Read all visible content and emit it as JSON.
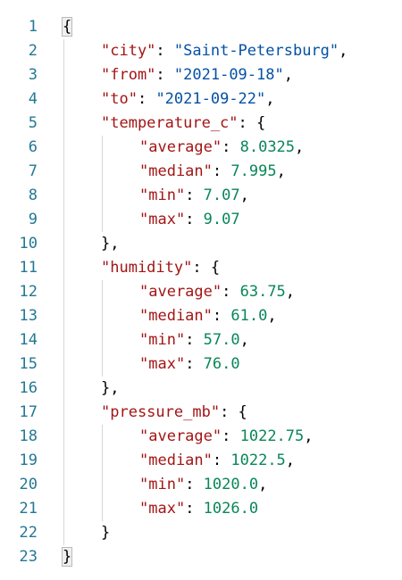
{
  "editor": {
    "colors": {
      "key": "#a31515",
      "string": "#0451a5",
      "number": "#098658",
      "line_number": "#237893"
    },
    "lines": [
      {
        "n": "1",
        "indent": 0,
        "tokens": [
          {
            "t": "{",
            "c": "pun",
            "hl": true
          }
        ]
      },
      {
        "n": "2",
        "indent": 1,
        "tokens": [
          {
            "t": "\"city\"",
            "c": "key"
          },
          {
            "t": ": ",
            "c": "pun"
          },
          {
            "t": "\"Saint-Petersburg\"",
            "c": "str"
          },
          {
            "t": ",",
            "c": "pun"
          }
        ]
      },
      {
        "n": "3",
        "indent": 1,
        "tokens": [
          {
            "t": "\"from\"",
            "c": "key"
          },
          {
            "t": ": ",
            "c": "pun"
          },
          {
            "t": "\"2021-09-18\"",
            "c": "str"
          },
          {
            "t": ",",
            "c": "pun"
          }
        ]
      },
      {
        "n": "4",
        "indent": 1,
        "tokens": [
          {
            "t": "\"to\"",
            "c": "key"
          },
          {
            "t": ": ",
            "c": "pun"
          },
          {
            "t": "\"2021-09-22\"",
            "c": "str"
          },
          {
            "t": ",",
            "c": "pun"
          }
        ]
      },
      {
        "n": "5",
        "indent": 1,
        "tokens": [
          {
            "t": "\"temperature_c\"",
            "c": "key"
          },
          {
            "t": ": {",
            "c": "pun"
          }
        ]
      },
      {
        "n": "6",
        "indent": 2,
        "tokens": [
          {
            "t": "\"average\"",
            "c": "key"
          },
          {
            "t": ": ",
            "c": "pun"
          },
          {
            "t": "8.0325",
            "c": "num"
          },
          {
            "t": ",",
            "c": "pun"
          }
        ]
      },
      {
        "n": "7",
        "indent": 2,
        "tokens": [
          {
            "t": "\"median\"",
            "c": "key"
          },
          {
            "t": ": ",
            "c": "pun"
          },
          {
            "t": "7.995",
            "c": "num"
          },
          {
            "t": ",",
            "c": "pun"
          }
        ]
      },
      {
        "n": "8",
        "indent": 2,
        "tokens": [
          {
            "t": "\"min\"",
            "c": "key"
          },
          {
            "t": ": ",
            "c": "pun"
          },
          {
            "t": "7.07",
            "c": "num"
          },
          {
            "t": ",",
            "c": "pun"
          }
        ]
      },
      {
        "n": "9",
        "indent": 2,
        "tokens": [
          {
            "t": "\"max\"",
            "c": "key"
          },
          {
            "t": ": ",
            "c": "pun"
          },
          {
            "t": "9.07",
            "c": "num"
          }
        ]
      },
      {
        "n": "10",
        "indent": 1,
        "tokens": [
          {
            "t": "},",
            "c": "pun"
          }
        ]
      },
      {
        "n": "11",
        "indent": 1,
        "tokens": [
          {
            "t": "\"humidity\"",
            "c": "key"
          },
          {
            "t": ": {",
            "c": "pun"
          }
        ]
      },
      {
        "n": "12",
        "indent": 2,
        "tokens": [
          {
            "t": "\"average\"",
            "c": "key"
          },
          {
            "t": ": ",
            "c": "pun"
          },
          {
            "t": "63.75",
            "c": "num"
          },
          {
            "t": ",",
            "c": "pun"
          }
        ]
      },
      {
        "n": "13",
        "indent": 2,
        "tokens": [
          {
            "t": "\"median\"",
            "c": "key"
          },
          {
            "t": ": ",
            "c": "pun"
          },
          {
            "t": "61.0",
            "c": "num"
          },
          {
            "t": ",",
            "c": "pun"
          }
        ]
      },
      {
        "n": "14",
        "indent": 2,
        "tokens": [
          {
            "t": "\"min\"",
            "c": "key"
          },
          {
            "t": ": ",
            "c": "pun"
          },
          {
            "t": "57.0",
            "c": "num"
          },
          {
            "t": ",",
            "c": "pun"
          }
        ]
      },
      {
        "n": "15",
        "indent": 2,
        "tokens": [
          {
            "t": "\"max\"",
            "c": "key"
          },
          {
            "t": ": ",
            "c": "pun"
          },
          {
            "t": "76.0",
            "c": "num"
          }
        ]
      },
      {
        "n": "16",
        "indent": 1,
        "tokens": [
          {
            "t": "},",
            "c": "pun"
          }
        ]
      },
      {
        "n": "17",
        "indent": 1,
        "tokens": [
          {
            "t": "\"pressure_mb\"",
            "c": "key"
          },
          {
            "t": ": {",
            "c": "pun"
          }
        ]
      },
      {
        "n": "18",
        "indent": 2,
        "tokens": [
          {
            "t": "\"average\"",
            "c": "key"
          },
          {
            "t": ": ",
            "c": "pun"
          },
          {
            "t": "1022.75",
            "c": "num"
          },
          {
            "t": ",",
            "c": "pun"
          }
        ]
      },
      {
        "n": "19",
        "indent": 2,
        "tokens": [
          {
            "t": "\"median\"",
            "c": "key"
          },
          {
            "t": ": ",
            "c": "pun"
          },
          {
            "t": "1022.5",
            "c": "num"
          },
          {
            "t": ",",
            "c": "pun"
          }
        ]
      },
      {
        "n": "20",
        "indent": 2,
        "tokens": [
          {
            "t": "\"min\"",
            "c": "key"
          },
          {
            "t": ": ",
            "c": "pun"
          },
          {
            "t": "1020.0",
            "c": "num"
          },
          {
            "t": ",",
            "c": "pun"
          }
        ]
      },
      {
        "n": "21",
        "indent": 2,
        "tokens": [
          {
            "t": "\"max\"",
            "c": "key"
          },
          {
            "t": ": ",
            "c": "pun"
          },
          {
            "t": "1026.0",
            "c": "num"
          }
        ]
      },
      {
        "n": "22",
        "indent": 1,
        "tokens": [
          {
            "t": "}",
            "c": "pun"
          }
        ]
      },
      {
        "n": "23",
        "indent": 0,
        "tokens": [
          {
            "t": "}",
            "c": "pun",
            "hl": true
          }
        ]
      }
    ]
  }
}
